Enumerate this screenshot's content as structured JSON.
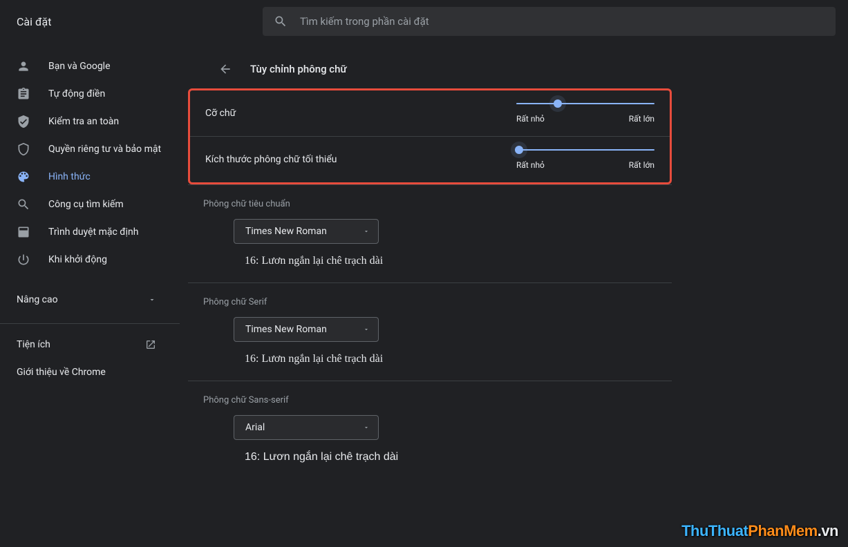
{
  "header": {
    "title": "Cài đặt",
    "search_placeholder": "Tìm kiếm trong phần cài đặt"
  },
  "sidebar": {
    "items": [
      {
        "label": "Bạn và Google"
      },
      {
        "label": "Tự động điền"
      },
      {
        "label": "Kiểm tra an toàn"
      },
      {
        "label": "Quyền riêng tư và bảo mật"
      },
      {
        "label": "Hình thức"
      },
      {
        "label": "Công cụ tìm kiếm"
      },
      {
        "label": "Trình duyệt mặc định"
      },
      {
        "label": "Khi khởi động"
      }
    ],
    "advanced": "Nâng cao",
    "extensions": "Tiện ích",
    "about": "Giới thiệu về Chrome"
  },
  "page": {
    "title": "Tùy chỉnh phông chữ",
    "slider1": {
      "label": "Cỡ chữ",
      "min_label": "Rất nhỏ",
      "max_label": "Rất lớn",
      "position_pct": 30
    },
    "slider2": {
      "label": "Kích thước phông chữ tối thiểu",
      "min_label": "Rất nhỏ",
      "max_label": "Rất lớn",
      "position_pct": 2
    },
    "font_standard": {
      "section": "Phông chữ tiêu chuẩn",
      "value": "Times New Roman",
      "sample": "16: Lươn ngắn lại chê trạch dài"
    },
    "font_serif": {
      "section": "Phông chữ Serif",
      "value": "Times New Roman",
      "sample": "16: Lươn ngắn lại chê trạch dài"
    },
    "font_sans": {
      "section": "Phông chữ Sans-serif",
      "value": "Arial",
      "sample": "16: Lươn ngắn lại chê trạch dài"
    }
  },
  "watermark": {
    "p1": "ThuThuat",
    "p2": "PhanMem",
    "p3": ".vn"
  },
  "colors": {
    "accent": "#8ab4f8",
    "highlight_border": "#e74c3c"
  }
}
